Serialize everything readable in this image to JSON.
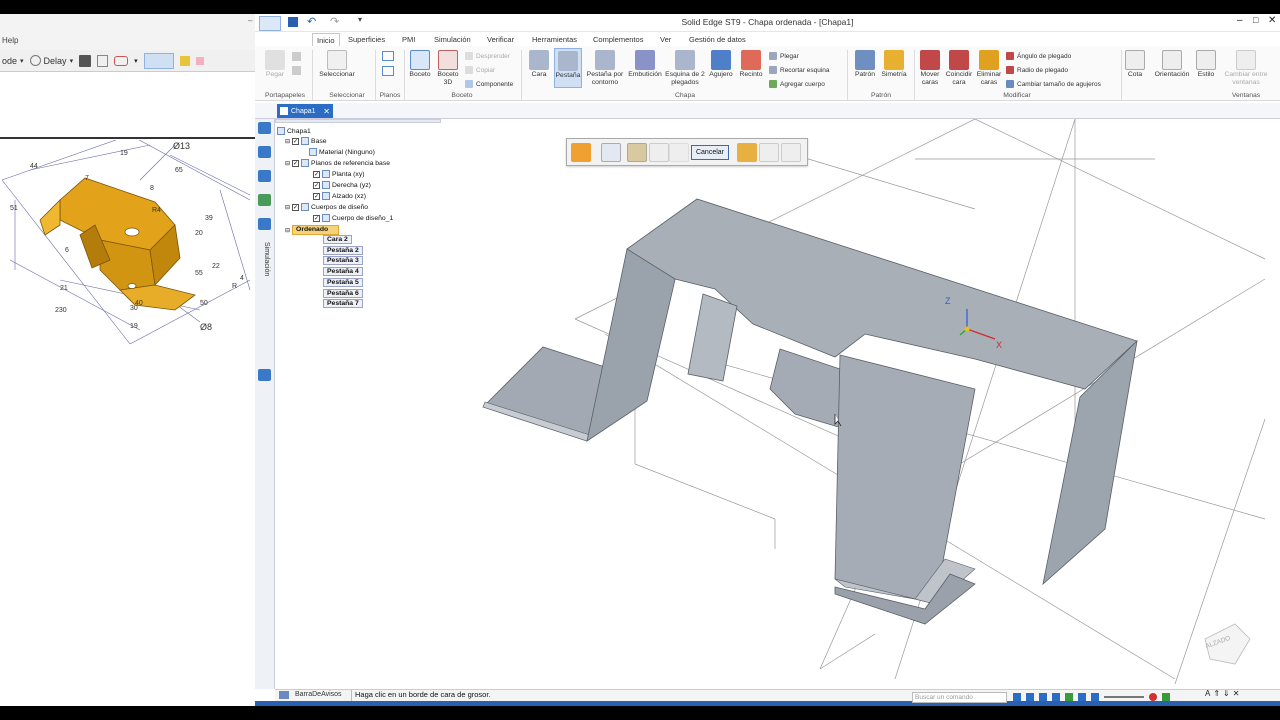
{
  "left_app": {
    "menu_help": "Help",
    "mode_label": "ode",
    "delay_label": "Delay",
    "drawing": {
      "dims": [
        "Ø13",
        "Ø8",
        "44",
        "19",
        "99",
        "65",
        "8",
        "39",
        "20",
        "51",
        "6",
        "21",
        "40",
        "22",
        "230",
        "19",
        "55",
        "50",
        "30",
        "7",
        "R",
        "4",
        "R4"
      ]
    }
  },
  "solid_edge": {
    "title": "Solid Edge ST9 - Chapa ordenada - [Chapa1]",
    "tabs": [
      "Inicio",
      "Superficies",
      "PMI",
      "Simulación",
      "Verificar",
      "Herramientas",
      "Complementos",
      "Ver",
      "Gestión de datos"
    ],
    "active_tab": "Inicio",
    "ribbon": {
      "portapapeles": {
        "group": "Portapapeles",
        "pegar": "Pegar"
      },
      "seleccionar": {
        "group": "Seleccionar",
        "btn": "Seleccionar"
      },
      "planos": {
        "group": "Planos",
        "btn": "Planos"
      },
      "boceto": {
        "group": "Boceto",
        "boceto": "Boceto",
        "boceto3d": "Boceto 3D",
        "desprender": "Desprender",
        "copiar": "Copiar",
        "componente": "Componente"
      },
      "chapa": {
        "group": "Chapa",
        "cara": "Cara",
        "pestana": "Pestaña",
        "pestana_contorno": "Pestaña por contorno",
        "embuticion": "Embutición",
        "esquina": "Esquina de 2 plegados",
        "agujero": "Agujero",
        "recinto": "Recinto",
        "plegar": "Plegar",
        "recortar": "Recortar esquina",
        "agregar": "Agregar cuerpo"
      },
      "patron": {
        "group": "Patrón",
        "patron": "Patrón",
        "simetria": "Simetría"
      },
      "modificar": {
        "group": "Modificar",
        "mover": "Mover caras",
        "coincidir": "Coincidir cara",
        "eliminar": "Eliminar caras",
        "angulo": "Ángulo de plegado",
        "radio": "Radio de plegado",
        "cambiar": "Cambiar tamaño de agujeros"
      },
      "cota": "Cota",
      "orientacion": "Orientación",
      "estilo": "Estilo",
      "ventanas": {
        "group": "Ventanas",
        "cambiar": "Cambiar entre ventanas"
      }
    },
    "doc_tab": "Chapa1",
    "tree": {
      "root": "Chapa1",
      "base": "Base",
      "material": "Material (Ninguno)",
      "planos": "Planos de referencia base",
      "planta": "Planta (xy)",
      "derecha": "Derecha (yz)",
      "alzado": "Alzado (xz)",
      "cuerpos": "Cuerpos de diseño",
      "cuerpo1": "Cuerpo de diseño_1",
      "ordenado": "Ordenado",
      "features": [
        "Cara 2",
        "Pestaña 2",
        "Pestaña 3",
        "Pestaña 4",
        "Pestaña 5",
        "Pestaña 6",
        "Pestaña 7"
      ]
    },
    "command_bar": {
      "cancel": "Cancelar"
    },
    "side_label": "Simulación",
    "view_cube": "ALZADO",
    "axes": {
      "z": "Z",
      "x": "X"
    },
    "status": {
      "bar_label": "BarraDeAvisos",
      "message": "Haga clic en un borde de cara de grosor."
    },
    "search_placeholder": "Buscar un comando",
    "colors": {
      "accent": "#2b6cc4",
      "part_gray": "#a9afb7",
      "drawing_gold": "#e2a21a"
    }
  }
}
